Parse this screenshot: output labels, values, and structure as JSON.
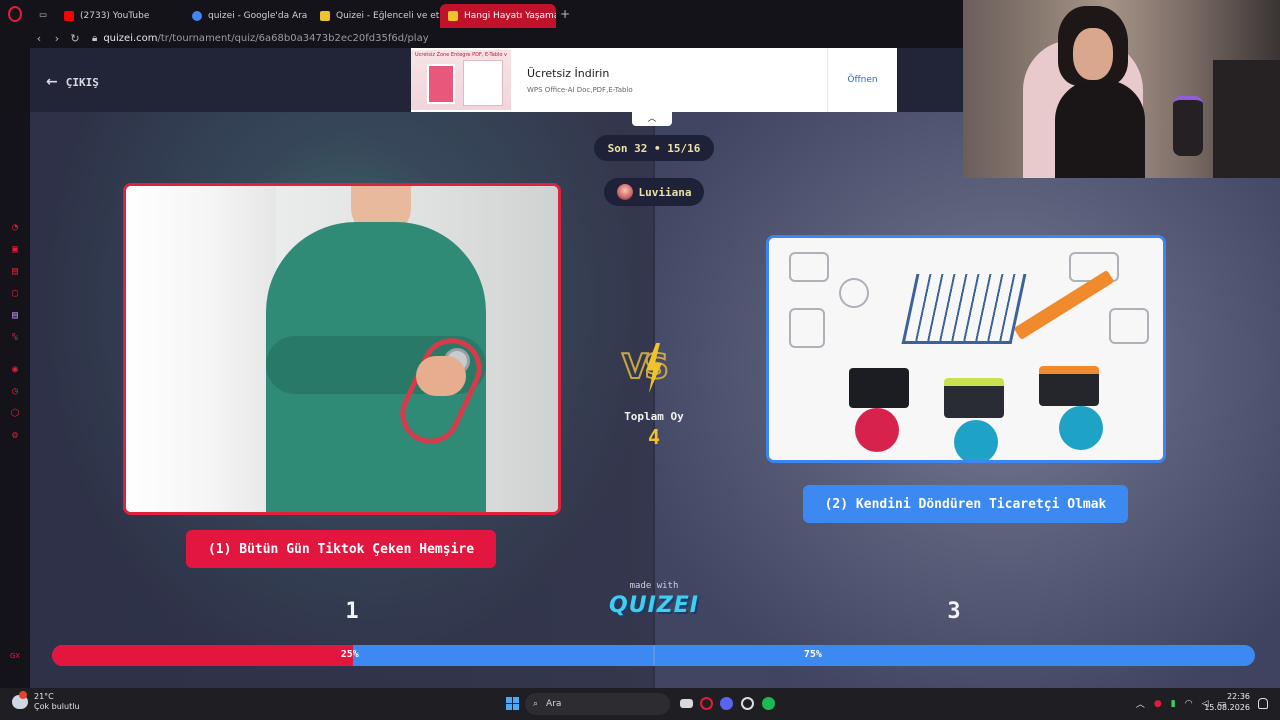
{
  "browser": {
    "tabs": [
      {
        "label": "(2733) YouTube",
        "color": "#ff0000"
      },
      {
        "label": "quizei - Google'da Ara",
        "color": "#4285f4"
      },
      {
        "label": "Quizei - Eğlenceli ve etkile",
        "color": "#f0c22b"
      },
      {
        "label": "Hangi Hayatı Yaşamak İster",
        "color": "#f0c22b",
        "active": true
      }
    ],
    "url_host": "quizei.com",
    "url_path": "/tr/tournament/quiz/6a68b0a3473b2ec20fd35f6d/play"
  },
  "page": {
    "exit_label": "ÇIKIŞ",
    "round_label": "Son 32 • 15/16",
    "user_name": "Luviiana",
    "total_label": "Toplam Oy",
    "total_votes": "4",
    "made_with": "made with",
    "brand": "QUIZEI"
  },
  "ad": {
    "thumb_title": "Ücretsiz Zone Entegre PDF, E-Tablo ve Word Uzmanı",
    "title": "Ücretsiz İndirin",
    "subtitle": "WPS Office-AI Doc,PDF,E-Tablo",
    "button": "Öffnen"
  },
  "options": [
    {
      "label": "(1) Bütün Gün Tiktok Çeken Hemşire",
      "votes": "1",
      "percent_label": "25%",
      "share": 25,
      "color": "#e3163f"
    },
    {
      "label": "(2) Kendini Döndüren Ticaretçi Olmak",
      "votes": "3",
      "percent_label": "75%",
      "share": 75,
      "color": "#3d89f2"
    }
  ],
  "taskbar": {
    "temperature": "21°C",
    "weather": "Çok bulutlu",
    "search_label": "Ara",
    "time": "22:36",
    "date": "15.08.2026"
  }
}
